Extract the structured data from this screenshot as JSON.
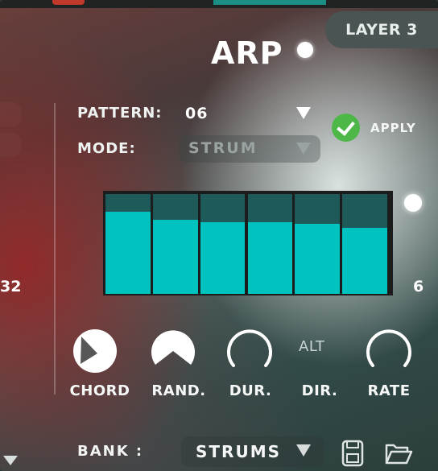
{
  "layer_tab": {
    "label": "LAYER 3"
  },
  "arp": {
    "title": "ARP"
  },
  "left_edge": {
    "value_32": "32"
  },
  "pattern": {
    "label": "PATTERN:",
    "value": "06"
  },
  "mode": {
    "label": "MODE:",
    "value": "STRUM"
  },
  "apply": {
    "label": "APPLY"
  },
  "steps": {
    "count_label": "6",
    "levels": [
      0.82,
      0.74,
      0.72,
      0.72,
      0.7,
      0.66
    ]
  },
  "knobs": [
    {
      "label": "CHORD",
      "icon": "filled-knob-icon"
    },
    {
      "label": "RAND.",
      "icon": "filled-knob-icon"
    },
    {
      "label": "DUR.",
      "icon": "ring-knob-icon"
    },
    {
      "label": "DIR.",
      "icon": "alt-text"
    },
    {
      "label": "RATE",
      "icon": "ring-knob-icon"
    }
  ],
  "direction": {
    "value": "ALT"
  },
  "bank": {
    "label": "BANK :",
    "value": "STRUMS"
  },
  "colors": {
    "accent": "#00c3bf",
    "step_bg": "#1e5a5a",
    "apply_green": "#4db848",
    "text": "#ffffff"
  }
}
